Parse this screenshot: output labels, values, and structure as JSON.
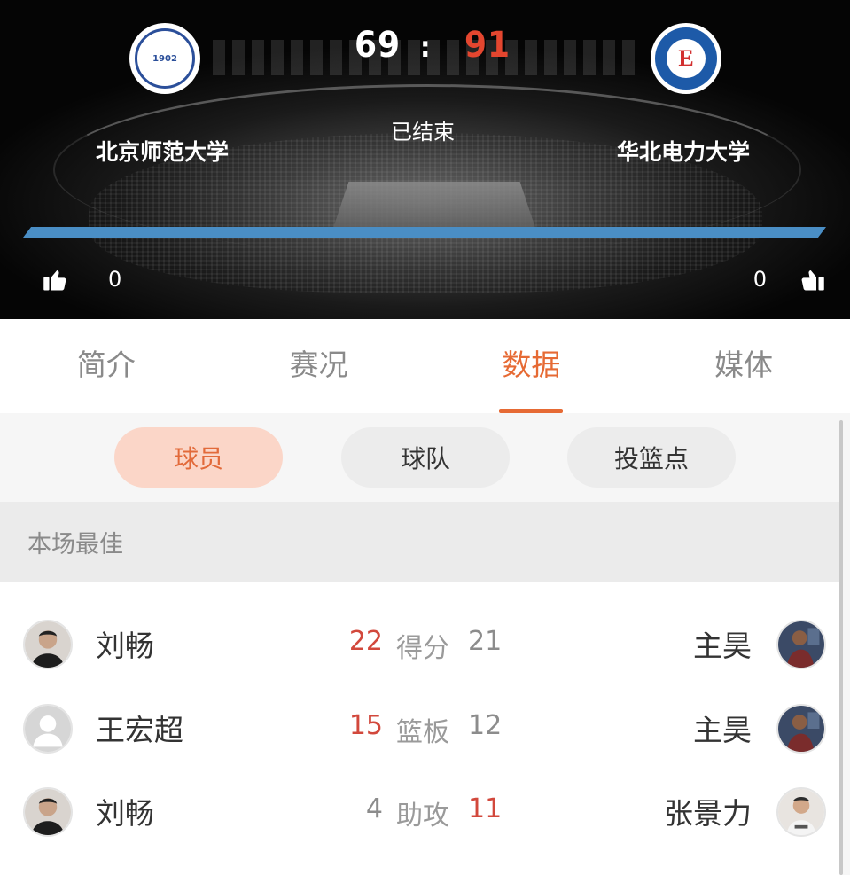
{
  "match": {
    "home": {
      "name": "北京师范大学",
      "score": "69",
      "logo_text": "1902",
      "likes": "0"
    },
    "away": {
      "name": "华北电力大学",
      "score": "91",
      "logo_text": "E",
      "likes": "0"
    },
    "separator": ":",
    "status": "已结束",
    "progress": {
      "home_fraction": 0.0,
      "away_fraction": 1.0
    }
  },
  "colors": {
    "accent": "#e66a34",
    "lead": "#d2483c",
    "away_bar": "#4a8ec5",
    "pill_active_bg": "#fbd6c8"
  },
  "icons": {
    "like_home": "thumbs-up-icon",
    "like_away": "thumbs-up-icon"
  },
  "tabs": [
    {
      "label": "简介",
      "active": false
    },
    {
      "label": "赛况",
      "active": false
    },
    {
      "label": "数据",
      "active": true
    },
    {
      "label": "媒体",
      "active": false
    }
  ],
  "subtabs": [
    {
      "label": "球员",
      "active": true
    },
    {
      "label": "球队",
      "active": false
    },
    {
      "label": "投篮点",
      "active": false
    }
  ],
  "section": {
    "title": "本场最佳"
  },
  "best_players": [
    {
      "home_player": "刘畅",
      "home_value": "22",
      "stat": "得分",
      "away_value": "21",
      "away_player": "主昊",
      "leader": "home"
    },
    {
      "home_player": "王宏超",
      "home_value": "15",
      "stat": "篮板",
      "away_value": "12",
      "away_player": "主昊",
      "leader": "home"
    },
    {
      "home_player": "刘畅",
      "home_value": "4",
      "stat": "助攻",
      "away_value": "11",
      "away_player": "张景力",
      "leader": "away"
    }
  ]
}
